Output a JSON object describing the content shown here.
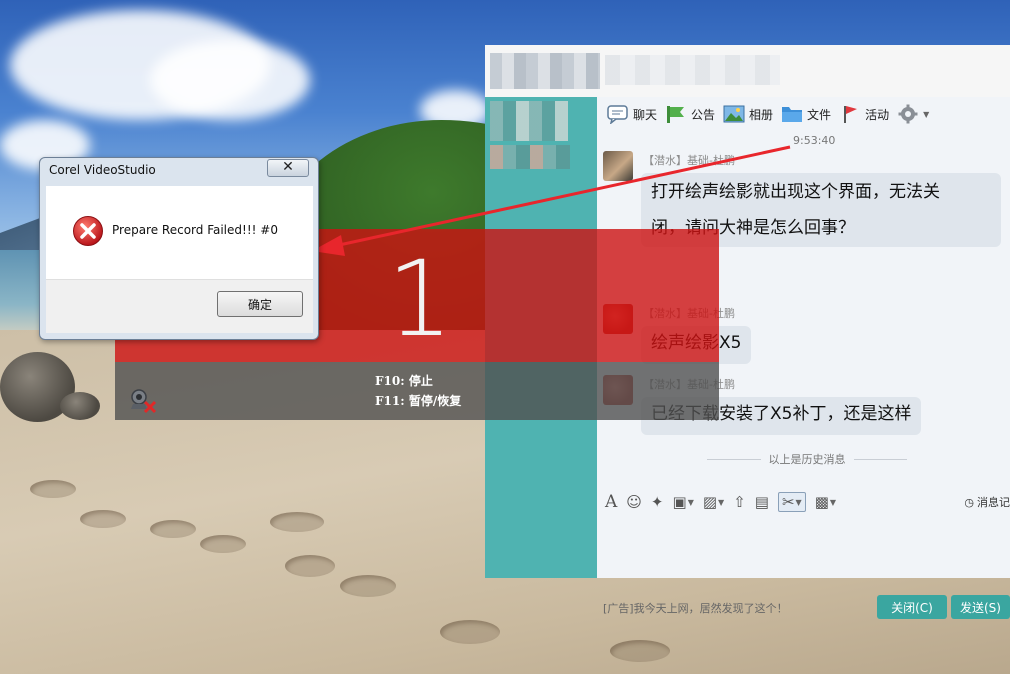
{
  "dialog": {
    "title": "Corel VideoStudio",
    "close_glyph": "✕",
    "message": "Prepare Record Failed!!! #0",
    "ok_label": "确定",
    "error_icon": "error-x-icon"
  },
  "recorder": {
    "countdown": "1",
    "hint_stop": "F10: 停止",
    "hint_pause": "F11: 暂停/恢复",
    "overlay_color": "#cd1212",
    "icon": "recorder-camera-icon"
  },
  "chat": {
    "toolbar": [
      {
        "label": "聊天",
        "icon": "chat-bubble-icon"
      },
      {
        "label": "公告",
        "icon": "announcement-flag-icon"
      },
      {
        "label": "相册",
        "icon": "photo-album-icon"
      },
      {
        "label": "文件",
        "icon": "folder-icon"
      },
      {
        "label": "活动",
        "icon": "activity-flag-icon"
      }
    ],
    "settings_icon": "gear-icon",
    "timestamp": "9:53:40",
    "messages": [
      {
        "sender": "【潜水】基础-杜鹏",
        "line1": "打开绘声绘影就出现这个界面，无法关",
        "line2": "闭，请问大神是怎么回事？"
      },
      {
        "sender": "【潜水】基础-杜鹏",
        "text": "绘声绘影X5"
      },
      {
        "sender": "【潜水】基础-杜鹏",
        "text": "已经下载安装了X5补丁，还是这样"
      }
    ],
    "history_label": "以上是历史消息",
    "input_tools": [
      "font-icon",
      "emoji-icon",
      "magic-wand-icon",
      "gif-icon",
      "image-icon",
      "upload-icon",
      "gift-icon",
      "scissors-icon",
      "screenshot-check-icon"
    ],
    "message_history_label": "消息记",
    "ad_text": "[广告]我今天上网，居然发现了这个！",
    "close_button": "关闭(C)",
    "send_button": "发送(S)",
    "accent_color": "#3aa6a0",
    "sidebar_color": "#4fb3b1"
  }
}
